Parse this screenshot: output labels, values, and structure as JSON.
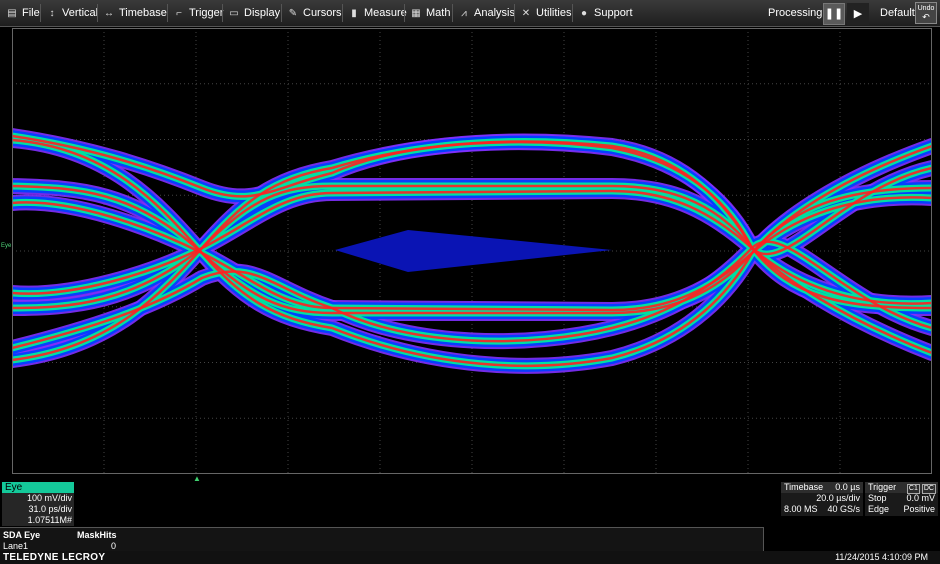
{
  "menu": {
    "items": [
      {
        "id": "file",
        "label": "File",
        "icon": "document-icon"
      },
      {
        "id": "vertical",
        "label": "Vertical",
        "icon": "vertical-arrows-icon"
      },
      {
        "id": "timebase",
        "label": "Timebase",
        "icon": "horizontal-arrows-icon"
      },
      {
        "id": "trigger",
        "label": "Trigger",
        "icon": "trigger-edge-icon"
      },
      {
        "id": "display",
        "label": "Display",
        "icon": "monitor-icon"
      },
      {
        "id": "cursors",
        "label": "Cursors",
        "icon": "cursor-icon"
      },
      {
        "id": "measure",
        "label": "Measure",
        "icon": "ruler-icon"
      },
      {
        "id": "math",
        "label": "Math",
        "icon": "calculator-icon"
      },
      {
        "id": "analysis",
        "label": "Analysis",
        "icon": "chart-icon"
      },
      {
        "id": "utilities",
        "label": "Utilities",
        "icon": "tools-icon"
      },
      {
        "id": "support",
        "label": "Support",
        "icon": "help-icon"
      }
    ],
    "processing_label": "Processing:",
    "default_label": "Default:",
    "undo_label": "Undo"
  },
  "channel_label": "Eye",
  "eye_trace": {
    "title": "Eye",
    "volts_per_div": "100 mV/div",
    "time_per_div": "31.0 ps/div",
    "count": "1.07511M#"
  },
  "timebase": {
    "title": "Timebase",
    "delay": "0.0 µs",
    "time_per_div": "20.0 µs/div",
    "samples": "8.00 MS",
    "sample_rate": "40 GS/s"
  },
  "trigger": {
    "title": "Trigger",
    "badge_c1": "C1",
    "badge_dc": "DC",
    "mode": "Stop",
    "level": "0.0 mV",
    "type": "Edge",
    "slope": "Positive"
  },
  "results": {
    "col1_header": "SDA Eye",
    "col2_header": "MaskHits",
    "row_label": "Lane1",
    "row_value": "0"
  },
  "status": {
    "brand": "TELEDYNE LECROY",
    "datetime": "11/24/2015 4:10:09 PM"
  },
  "colors": {
    "trace_hot": "#ff2020",
    "trace_mid": "#00e0a0",
    "trace_cool": "#0040ff",
    "trace_edge": "#8030ff",
    "mask": "#0a14b4",
    "eye_tag": "#14c99a"
  }
}
